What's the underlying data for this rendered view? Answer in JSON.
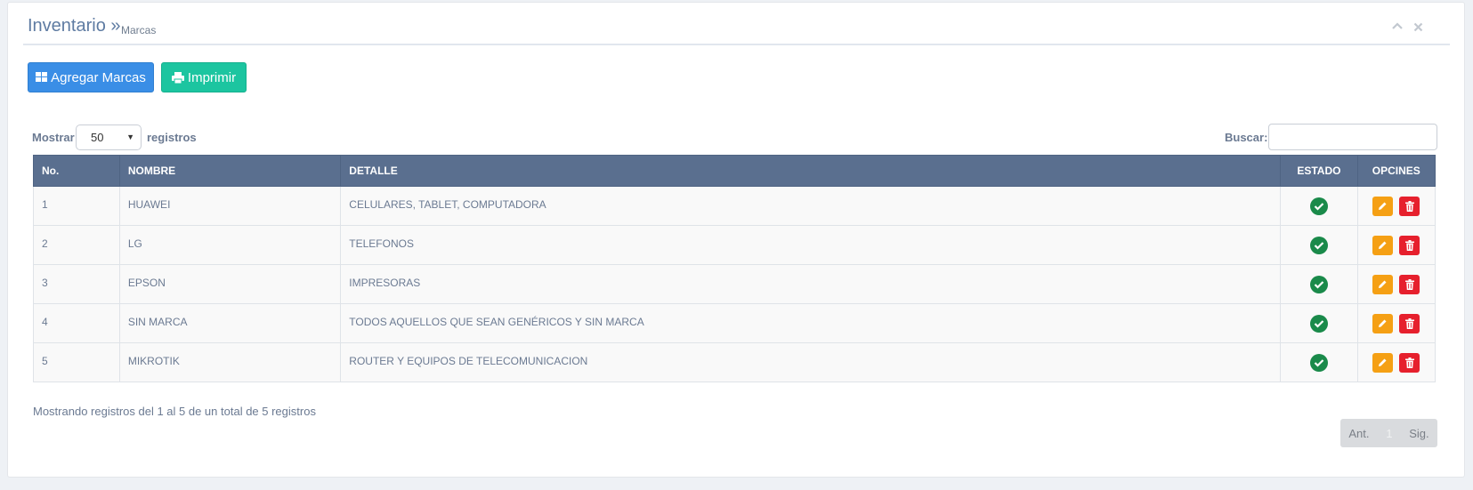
{
  "header": {
    "title": "Inventario »",
    "subtitle": "Marcas"
  },
  "toolbar": {
    "add_label": "Agregar Marcas",
    "print_label": "Imprimir"
  },
  "length": {
    "prefix": "Mostrar",
    "value": "50",
    "suffix": "registros"
  },
  "search": {
    "label": "Buscar:",
    "value": ""
  },
  "table": {
    "columns": [
      "No.",
      "NOMBRE",
      "DETALLE",
      "ESTADO",
      "OPCINES"
    ],
    "rows": [
      {
        "no": "1",
        "nombre": "HUAWEI",
        "detalle": "CELULARES, TABLET, COMPUTADORA",
        "estado": "active"
      },
      {
        "no": "2",
        "nombre": "LG",
        "detalle": "TELEFONOS",
        "estado": "active"
      },
      {
        "no": "3",
        "nombre": "EPSON",
        "detalle": "IMPRESORAS",
        "estado": "active"
      },
      {
        "no": "4",
        "nombre": "SIN MARCA",
        "detalle": "TODOS AQUELLOS QUE SEAN GENÉRICOS Y SIN MARCA",
        "estado": "active"
      },
      {
        "no": "5",
        "nombre": "MIKROTIK",
        "detalle": "ROUTER Y EQUIPOS DE TELECOMUNICACION",
        "estado": "active"
      }
    ]
  },
  "info": "Mostrando registros del 1 al 5 de un total de 5 registros",
  "pagination": {
    "prev": "Ant.",
    "current": "1",
    "next": "Sig."
  },
  "colors": {
    "header_bg": "#5a6f8f",
    "add_button": "#3a8ee6",
    "print_button": "#1cc5a0",
    "status_ok": "#1a8a4a",
    "edit_button": "#f5a014",
    "delete_button": "#e6202d"
  }
}
